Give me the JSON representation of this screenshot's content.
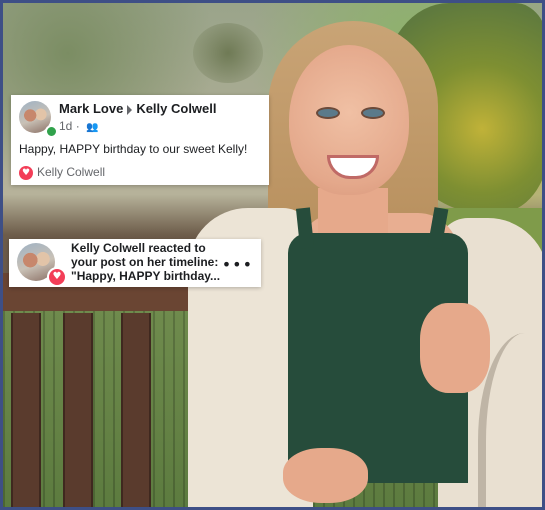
{
  "post": {
    "author": "Mark Love",
    "recipient": "Kelly Colwell",
    "time": "1d",
    "audience_icon": "friends-icon",
    "text": "Happy, HAPPY birthday to our sweet Kelly!",
    "reaction_icon": "heart-icon",
    "reactor": "Kelly Colwell"
  },
  "notification": {
    "actor": "Kelly Colwell",
    "line1": " reacted to",
    "line2": "your post on her timeline:",
    "line3": "\"Happy, HAPPY birthday...",
    "reaction_icon": "heart-icon",
    "more_icon": "more-options-icon"
  },
  "colors": {
    "frame_border": "#3e4f86",
    "love_reaction": "#f33e58",
    "online": "#31a24c"
  }
}
